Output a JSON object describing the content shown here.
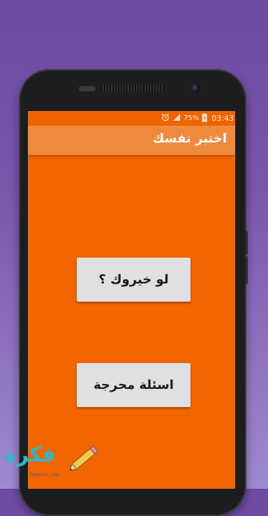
{
  "status_bar": {
    "battery": "75%",
    "time": "03:43",
    "icons": [
      "alarm-icon",
      "signal-icon",
      "battery-charging-icon"
    ]
  },
  "app_bar": {
    "title": "اختبر نفسك"
  },
  "buttons": {
    "first": "لو خيروك ؟",
    "second": "اسئلة محرجة"
  },
  "watermark": {
    "logo_text": "فكرة",
    "domain": "fekera.com"
  },
  "colors": {
    "background": "#7b56ad",
    "screen": "#f26500",
    "app_bar": "#ef8a3d",
    "button": "#e0e0e0"
  }
}
